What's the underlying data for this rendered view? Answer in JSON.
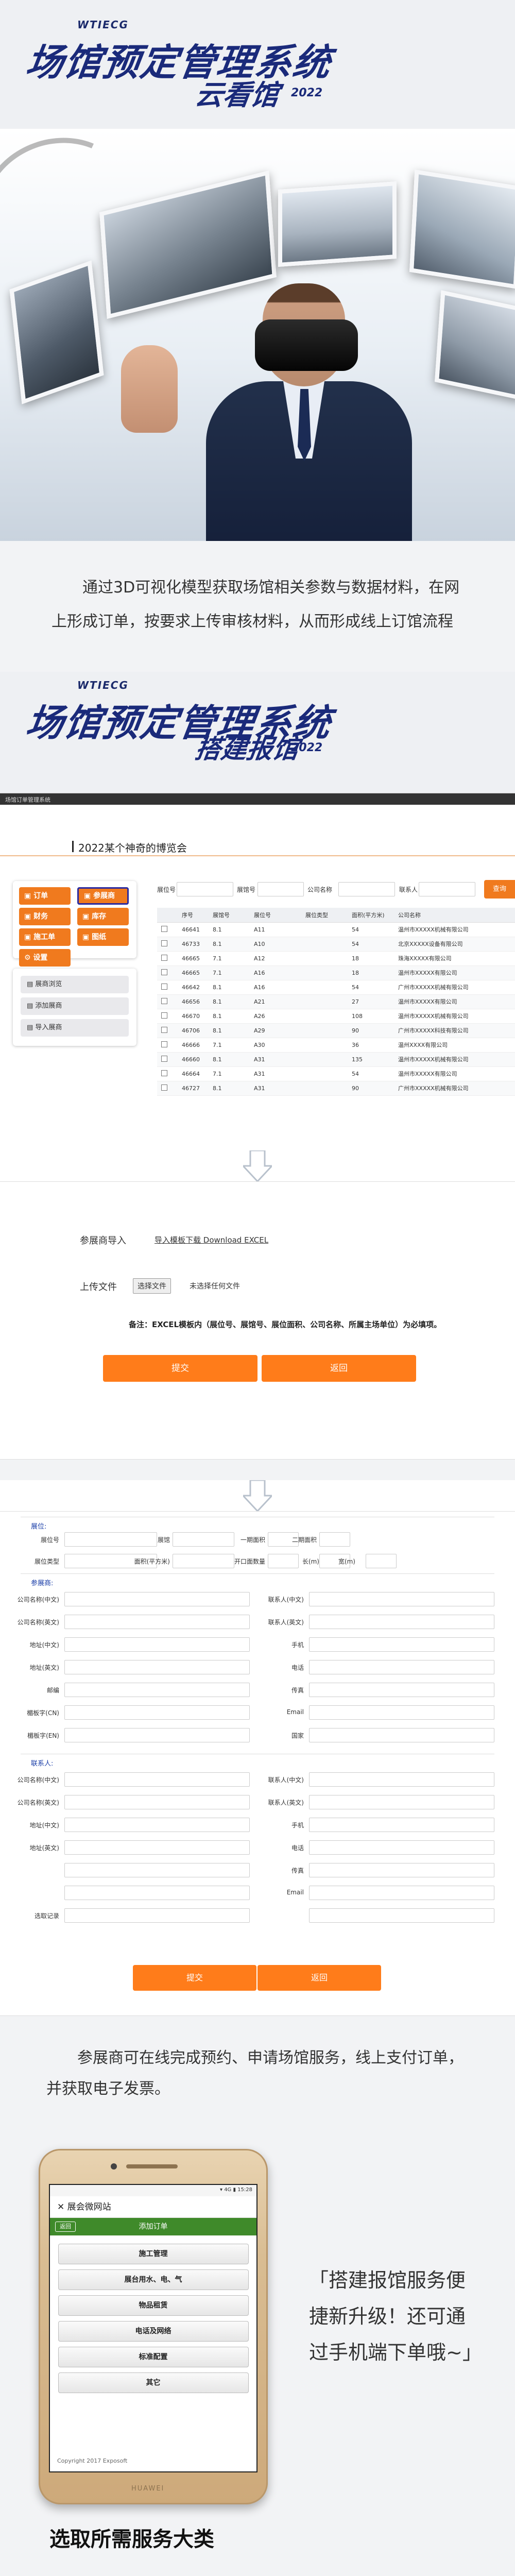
{
  "section1": {
    "brand": "WTIECG",
    "title": "场馆预定管理系统",
    "subtitle": "云看馆",
    "year": "2022"
  },
  "intro1": "通过3D可视化模型获取场馆相关参数与数据材料，在网上形成订单，按要求上传审核材料，从而形成线上订馆流程",
  "section2": {
    "brand": "WTIECG",
    "title": "场馆预定管理系统",
    "subtitle": "搭建报馆",
    "year": "2022"
  },
  "app1": {
    "topbar": "场馆订单管理系统",
    "expo_title": "2022某个神奇的博览会",
    "menu": [
      "订单",
      "参展商",
      "财务",
      "库存",
      "施工单",
      "图纸",
      "设置"
    ],
    "side_menu": [
      "展商浏览",
      "添加展商",
      "导入展商"
    ],
    "filters": [
      {
        "label": "展位号"
      },
      {
        "label": "展馆号"
      },
      {
        "label": "公司名称"
      },
      {
        "label": "联系人"
      }
    ],
    "search_button": "查询",
    "columns": [
      "",
      "序号",
      "展馆号",
      "展位号",
      "展位类型",
      "面积(平方米)",
      "公司名称"
    ],
    "rows": [
      [
        "",
        "46641",
        "8.1",
        "A11",
        "",
        "54",
        "温州市XXXXX机械有限公司"
      ],
      [
        "",
        "46733",
        "8.1",
        "A10",
        "",
        "54",
        "北京XXXXX设备有限公司"
      ],
      [
        "",
        "46665",
        "7.1",
        "A12",
        "",
        "18",
        "珠海XXXXX有限公司"
      ],
      [
        "",
        "46665",
        "7.1",
        "A16",
        "",
        "18",
        "温州市XXXXX有限公司"
      ],
      [
        "",
        "46642",
        "8.1",
        "A16",
        "",
        "54",
        "广州市XXXXX机械有限公司"
      ],
      [
        "",
        "46656",
        "8.1",
        "A21",
        "",
        "27",
        "温州市XXXXX有限公司"
      ],
      [
        "",
        "46670",
        "8.1",
        "A26",
        "",
        "108",
        "温州市XXXXX机械有限公司"
      ],
      [
        "",
        "46706",
        "8.1",
        "A29",
        "",
        "90",
        "广州市XXXXX科技有限公司"
      ],
      [
        "",
        "46666",
        "7.1",
        "A30",
        "",
        "36",
        "温州XXXX有限公司"
      ],
      [
        "",
        "46660",
        "8.1",
        "A31",
        "",
        "135",
        "温州市XXXXX机械有限公司"
      ],
      [
        "",
        "46664",
        "7.1",
        "A31",
        "",
        "54",
        "温州市XXXXX有限公司"
      ],
      [
        "",
        "46727",
        "8.1",
        "A31",
        "",
        "90",
        "广州市XXXXX机械有限公司"
      ]
    ]
  },
  "import": {
    "label_import": "参展商导入",
    "template_link": "导入模板下载 Download EXCEL",
    "label_upload": "上传文件",
    "choose_file": "选择文件",
    "no_file": "未选择任何文件",
    "note": "备注：EXCEL模板内（展位号、展馆号、展位面积、公司名称、所属主场单位）为必填项。",
    "submit": "提交",
    "back": "返回"
  },
  "form2": {
    "section_booth": "展位:",
    "section_exhibitor": "参展商:",
    "section_contact": "联系人:",
    "booth_fields": [
      "展位号",
      "展馆",
      "一期面积",
      "二期面积",
      "展位类型",
      "面积(平方米)",
      "开口面数量",
      "长(m)",
      "宽(m)"
    ],
    "left_fields": [
      "公司名称(中文)",
      "公司名称(英文)",
      "地址(中文)",
      "地址(英文)",
      "邮编",
      "楣板字(CN)",
      "楣板字(EN)"
    ],
    "right_fields": [
      "联系人(中文)",
      "联系人(英文)",
      "手机",
      "电话",
      "传真",
      "Email",
      "国家"
    ],
    "contact_left": [
      "公司名称(中文)",
      "公司名称(英文)",
      "地址(中文)",
      "地址(英文)",
      "",
      "",
      "选取记录"
    ],
    "contact_right": [
      "联系人(中文)",
      "联系人(英文)",
      "手机",
      "电话",
      "传真",
      "Email",
      ""
    ],
    "submit": "提交",
    "back": "返回"
  },
  "intro2": "参展商可在线完成预约、申请场馆服务，线上支付订单，并获取电子发票。",
  "phone": {
    "status": "▾ 4G ▮ 15:28",
    "nav_title": "展会微网站",
    "back": "返回",
    "page_title": "添加订单",
    "services": [
      "施工管理",
      "展台用水、电、气",
      "物品租赁",
      "电话及网络",
      "标准配置",
      "其它"
    ],
    "copyright": "Copyright 2017 Exposoft",
    "brand": "HUAWEI"
  },
  "quote": "「搭建报馆服务便捷新升级！还可通过手机端下单哦~」",
  "caption": "选取所需服务大类",
  "colors": {
    "navy": "#1a2a7a",
    "orange": "#ff7c1a",
    "green": "#3f8a2a"
  }
}
